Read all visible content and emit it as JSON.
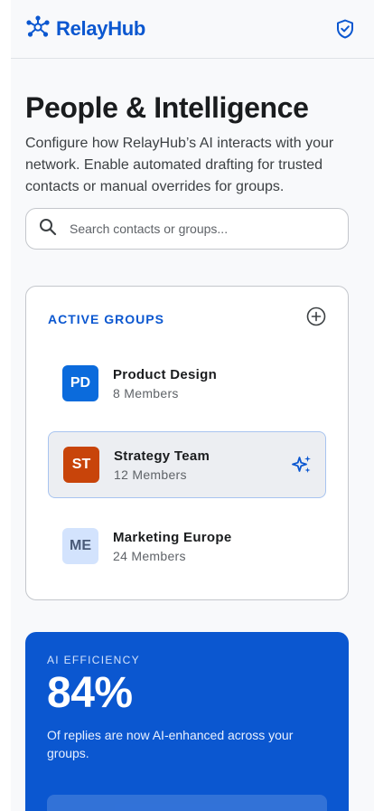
{
  "app": {
    "name": "RelayHub",
    "brand_color": "#0b57d0"
  },
  "header": {
    "logo_icon": "network-nodes-icon",
    "shield_icon": "shield-check-icon"
  },
  "page": {
    "title": "People & Intelligence",
    "description": "Configure how RelayHub’s AI interacts with your network. Enable automated drafting for trusted contacts or manual overrides for groups."
  },
  "search": {
    "placeholder": "Search contacts or groups...",
    "value": ""
  },
  "groups": {
    "heading": "ACTIVE GROUPS",
    "add_icon": "add-circle-icon",
    "items": [
      {
        "initials": "PD",
        "name": "Product Design",
        "members": "8 Members",
        "avatar_bg": "#0b6bdc",
        "avatar_fg": "#ffffff",
        "active": false
      },
      {
        "initials": "ST",
        "name": "Strategy Team",
        "members": "12 Members",
        "avatar_bg": "#c8440a",
        "avatar_fg": "#ffffff",
        "active": true
      },
      {
        "initials": "ME",
        "name": "Marketing Europe",
        "members": "24 Members",
        "avatar_bg": "#d3e3fd",
        "avatar_fg": "#4a5a78",
        "active": false
      }
    ]
  },
  "ai_efficiency": {
    "label": "AI EFFICIENCY",
    "value": "84%",
    "description": "Of replies are now AI-enhanced across your groups.",
    "card_color": "#0b57d0"
  }
}
